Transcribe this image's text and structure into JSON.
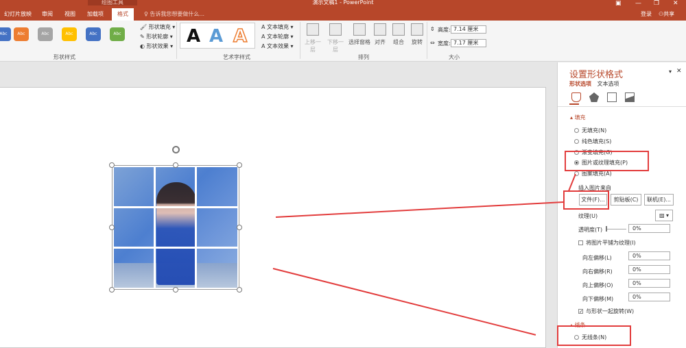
{
  "titlebar": {
    "context_tab": "绘图工具",
    "doc_title": "演示文稿1 - PowerPoint",
    "tabs": [
      "幻灯片放映",
      "审阅",
      "视图",
      "加载项",
      "格式"
    ],
    "tell_me": "告诉我您想要做什么...",
    "login": "登录",
    "share": "共享"
  },
  "ribbon": {
    "shape_styles": {
      "labels": [
        "Abc",
        "Abc",
        "Abc",
        "Abc",
        "Abc",
        "Abc"
      ],
      "colors": [
        "#4472c4",
        "#ed7d31",
        "#a5a5a5",
        "#ffc000",
        "#4472c4",
        "#70ad47"
      ],
      "fill": "形状填充",
      "outline": "形状轮廓",
      "effects": "形状效果",
      "group": "形状样式"
    },
    "wordart": {
      "letters": [
        "A",
        "A",
        "A"
      ],
      "fill": "文本填充",
      "outline": "文本轮廓",
      "effects": "文本效果",
      "group": "艺术字样式"
    },
    "arrange": {
      "bring_forward": "上移一层",
      "send_backward": "下移一层",
      "selection_pane": "选择窗格",
      "align": "对齐",
      "group_btn": "组合",
      "rotate": "旋转",
      "group": "排列"
    },
    "size": {
      "height_label": "高度:",
      "height": "7.14 厘米",
      "width_label": "宽度:",
      "width": "7.17 厘米",
      "group": "大小"
    }
  },
  "pane": {
    "title": "设置形状格式",
    "tab_shape": "形状选项",
    "tab_text": "文本选项",
    "fill_section": "填充",
    "fill_options": [
      "无填充(N)",
      "纯色填充(S)",
      "渐变填充(G)",
      "图片或纹理填充(P)",
      "图案填充(A)"
    ],
    "insert_from": "插入图片来自",
    "btn_file": "文件(F)...",
    "btn_clipboard": "剪贴板(C)",
    "btn_online": "联机(E)...",
    "texture": "纹理(U)",
    "transparency": "透明度(T)",
    "transparency_val": "0%",
    "tile": "将图片平铺为纹理(I)",
    "offsets": [
      {
        "label": "向左偏移(L)",
        "val": "0%"
      },
      {
        "label": "向右偏移(R)",
        "val": "0%"
      },
      {
        "label": "向上偏移(O)",
        "val": "0%"
      },
      {
        "label": "向下偏移(M)",
        "val": "0%"
      }
    ],
    "rotate_with": "与形状一起旋转(W)",
    "line_section": "线条",
    "line_none": "无线条(N)"
  }
}
